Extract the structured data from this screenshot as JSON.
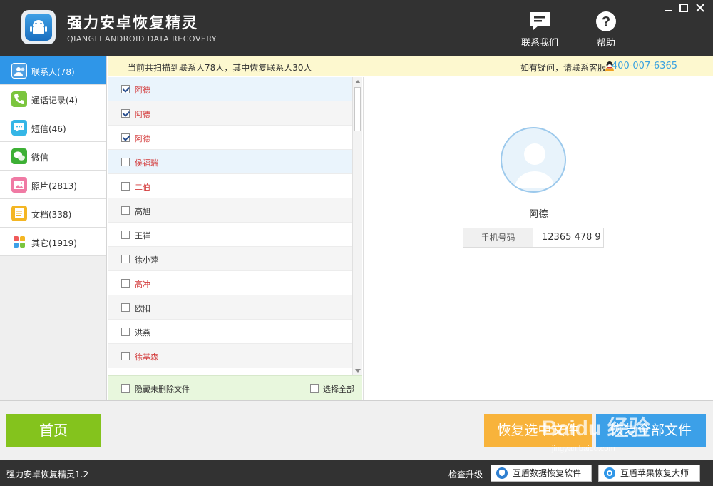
{
  "app": {
    "title": "强力安卓恢复精灵",
    "subtitle": "QIANGLI ANDROID DATA RECOVERY",
    "contact_label": "联系我们",
    "help_label": "帮助"
  },
  "sidebar": {
    "items": [
      {
        "label": "联系人(78)",
        "icon": "contacts-icon",
        "active": true
      },
      {
        "label": "通话记录(4)",
        "icon": "phone-icon",
        "active": false
      },
      {
        "label": "短信(46)",
        "icon": "sms-icon",
        "active": false
      },
      {
        "label": "微信",
        "icon": "wechat-icon",
        "active": false
      },
      {
        "label": "照片(2813)",
        "icon": "photo-icon",
        "active": false
      },
      {
        "label": "文档(338)",
        "icon": "document-icon",
        "active": false
      },
      {
        "label": "其它(1919)",
        "icon": "other-icon",
        "active": false
      }
    ]
  },
  "infobar": {
    "summary": "当前共扫描到联系人78人，其中恢复联系人30人",
    "help_text": "如有疑问，请联系客服",
    "phone": "400-007-6365"
  },
  "contacts": [
    {
      "name": "阿德",
      "checked": true,
      "deleted": true
    },
    {
      "name": "阿德",
      "checked": true,
      "deleted": true
    },
    {
      "name": "阿德",
      "checked": true,
      "deleted": true
    },
    {
      "name": "侯福瑞",
      "checked": false,
      "deleted": true
    },
    {
      "name": "二伯",
      "checked": false,
      "deleted": true
    },
    {
      "name": "高旭",
      "checked": false,
      "deleted": false
    },
    {
      "name": "王祥",
      "checked": false,
      "deleted": false
    },
    {
      "name": "徐小萍",
      "checked": false,
      "deleted": false
    },
    {
      "name": "高冲",
      "checked": false,
      "deleted": true
    },
    {
      "name": "欧阳",
      "checked": false,
      "deleted": false
    },
    {
      "name": "洪燕",
      "checked": false,
      "deleted": false
    },
    {
      "name": "徐基森",
      "checked": false,
      "deleted": true
    }
  ],
  "list_footer": {
    "hide_label": "隐藏未删除文件",
    "select_all_label": "选择全部"
  },
  "detail": {
    "name": "阿德",
    "phone_key": "手机号码",
    "phone_value": "12365 478 9"
  },
  "actions": {
    "home": "首页",
    "recover_selected": "恢复选中文件",
    "recover_all": "恢复全部文件"
  },
  "watermark": {
    "brand": "Baidu 经验",
    "url": "jingyan.baidu.com"
  },
  "statusbar": {
    "version": "强力安卓恢复精灵1.2",
    "check_update": "检查升级",
    "btn1": "互盾数据恢复软件",
    "btn2": "互盾苹果恢复大师"
  },
  "colors": {
    "titlebar": "#323232",
    "accent_blue": "#2f96e8",
    "green": "#84c31d",
    "orange": "#f8b33b",
    "red_text": "#d33a3a"
  }
}
